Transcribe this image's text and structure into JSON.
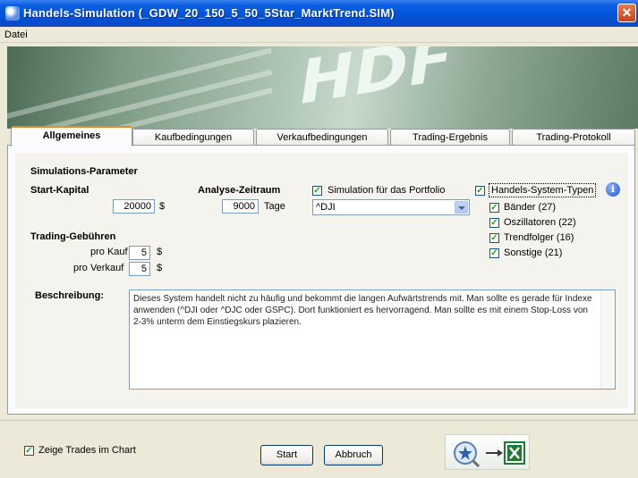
{
  "window": {
    "title": "Handels-Simulation (_GDW_20_150_5_50_5Star_MarktTrend.SIM)",
    "close_glyph": "✕"
  },
  "menu": {
    "items": [
      "Datei"
    ]
  },
  "banner": {
    "text": "HDF"
  },
  "tabs": [
    {
      "label": "Allgemeines",
      "active": true
    },
    {
      "label": "Kaufbedingungen",
      "active": false
    },
    {
      "label": "Verkaufbedingungen",
      "active": false
    },
    {
      "label": "Trading-Ergebnis",
      "active": false
    },
    {
      "label": "Trading-Protokoll",
      "active": false
    }
  ],
  "params": {
    "section_title": "Simulations-Parameter",
    "start_capital": {
      "label": "Start-Kapital",
      "value": "20000",
      "unit": "$"
    },
    "analysis_period": {
      "label": "Analyse-Zeitraum",
      "value": "9000",
      "unit": "Tage"
    },
    "portfolio_sim": {
      "label": "Simulation für das Portfolio",
      "checked": true,
      "selected": "^DJI"
    },
    "fees": {
      "label": "Trading-Gebühren",
      "buy": {
        "label": "pro Kauf",
        "value": "5",
        "unit": "$"
      },
      "sell": {
        "label": "pro Verkauf",
        "value": "5",
        "unit": "$"
      }
    },
    "system_types": {
      "label": "Handels-System-Typen",
      "checked": true,
      "items": [
        {
          "label": "Bänder (27)",
          "checked": true
        },
        {
          "label": "Oszillatoren (22)",
          "checked": true
        },
        {
          "label": "Trendfolger (16)",
          "checked": true
        },
        {
          "label": "Sonstige (21)",
          "checked": true
        }
      ]
    }
  },
  "description": {
    "label": "Beschreibung:",
    "text": "Dieses System handelt nicht zu häufig und bekommt die langen Aufwärtstrends mit. Man sollte es gerade für Indexe anwenden (^DJI oder ^DJC oder GSPC). Dort funktioniert es hervorragend. Man sollte es mit einem Stop-Loss von 2-3% unterm dem Einstiegskurs plazieren."
  },
  "footer": {
    "show_trades": {
      "label": "Zeige Trades im Chart",
      "checked": true
    },
    "start_button": "Start",
    "cancel_button": "Abbruch"
  },
  "icons": {
    "check": "✓",
    "info": "i"
  },
  "colors": {
    "titlebar": "#0152d6",
    "accent_tab": "#e68b2c",
    "excel_green": "#1e7b34"
  }
}
